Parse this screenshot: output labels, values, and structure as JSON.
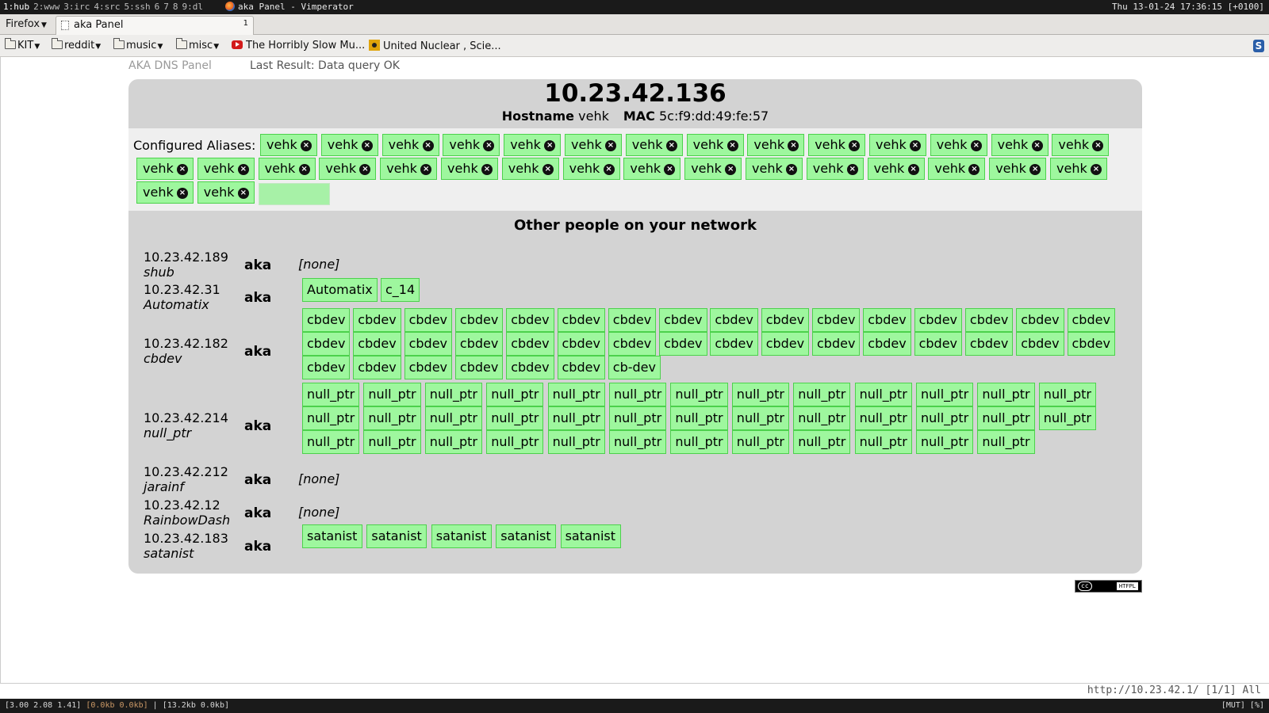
{
  "wm": {
    "workspaces": [
      "1:hub",
      "2:www",
      "3:irc",
      "4:src",
      "5:ssh",
      "6",
      "7",
      "8",
      "9:dl"
    ],
    "active_window": "aka Panel - Vimperator",
    "clock": "Thu 13-01-24 17:36:15 [+0100]"
  },
  "browser": {
    "menu_label": "Firefox",
    "tab_title": "aka Panel",
    "tab_number": "1",
    "bookmarks": {
      "kit": "KIT",
      "reddit": "reddit",
      "music": "music",
      "misc": "misc",
      "horribly": "The Horribly Slow Mu...",
      "nuclear": "United Nuclear , Scie..."
    },
    "status_url": "http://10.23.42.1/ [1/1] All"
  },
  "page": {
    "panel_name": "AKA DNS Panel",
    "last_result_label": "Last Result:",
    "last_result_value": "Data query OK",
    "ip": "10.23.42.136",
    "hostname_label": "Hostname",
    "hostname": "vehk",
    "mac_label": "MAC",
    "mac": "5c:f9:dd:49:fe:57",
    "aliases_label": "Configured Aliases:",
    "alias_remove_symbol": "×",
    "aliases": [
      "vehk",
      "vehk",
      "vehk",
      "vehk",
      "vehk",
      "vehk",
      "vehk",
      "vehk",
      "vehk",
      "vehk",
      "vehk",
      "vehk",
      "vehk",
      "vehk",
      "vehk",
      "vehk",
      "vehk",
      "vehk",
      "vehk",
      "vehk",
      "vehk",
      "vehk",
      "vehk",
      "vehk",
      "vehk",
      "vehk",
      "vehk",
      "vehk",
      "vehk",
      "vehk",
      "vehk",
      "vehk"
    ],
    "others_title": "Other people on your network",
    "aka_label": "aka",
    "none_label": "[none]",
    "peers": [
      {
        "ip": "10.23.42.189",
        "host": "shub",
        "aliases": []
      },
      {
        "ip": "10.23.42.31",
        "host": "Automatix",
        "aliases": [
          "Automatix",
          "c_14"
        ]
      },
      {
        "ip": "10.23.42.182",
        "host": "cbdev",
        "aliases": [
          "cbdev",
          "cbdev",
          "cbdev",
          "cbdev",
          "cbdev",
          "cbdev",
          "cbdev",
          "cbdev",
          "cbdev",
          "cbdev",
          "cbdev",
          "cbdev",
          "cbdev",
          "cbdev",
          "cbdev",
          "cbdev",
          "cbdev",
          "cbdev",
          "cbdev",
          "cbdev",
          "cbdev",
          "cbdev",
          "cbdev",
          "cbdev",
          "cbdev",
          "cbdev",
          "cbdev",
          "cbdev",
          "cbdev",
          "cbdev",
          "cbdev",
          "cbdev",
          "cbdev",
          "cbdev",
          "cbdev",
          "cbdev",
          "cbdev",
          "cbdev",
          "cb-dev"
        ]
      },
      {
        "ip": "10.23.42.214",
        "host": "null_ptr",
        "aliases": [
          "null_ptr",
          "null_ptr",
          "null_ptr",
          "null_ptr",
          "null_ptr",
          "null_ptr",
          "null_ptr",
          "null_ptr",
          "null_ptr",
          "null_ptr",
          "null_ptr",
          "null_ptr",
          "null_ptr",
          "null_ptr",
          "null_ptr",
          "null_ptr",
          "null_ptr",
          "null_ptr",
          "null_ptr",
          "null_ptr",
          "null_ptr",
          "null_ptr",
          "null_ptr",
          "null_ptr",
          "null_ptr",
          "null_ptr",
          "null_ptr",
          "null_ptr",
          "null_ptr",
          "null_ptr",
          "null_ptr",
          "null_ptr",
          "null_ptr",
          "null_ptr",
          "null_ptr",
          "null_ptr",
          "null_ptr",
          "null_ptr"
        ]
      },
      {
        "ip": "10.23.42.212",
        "host": "jarainf",
        "aliases": []
      },
      {
        "ip": "10.23.42.12",
        "host": "RainbowDash",
        "aliases": []
      },
      {
        "ip": "10.23.42.183",
        "host": "satanist",
        "aliases": [
          "satanist",
          "satanist",
          "satanist",
          "satanist",
          "satanist"
        ]
      }
    ],
    "license_badge": "cc",
    "license_text": "HTFPL"
  },
  "bottom_bar": {
    "load": "[3.00 2.08 1.41]",
    "net1": "[0.0kb 0.0kb]",
    "net2": "[13.2kb 0.0kb]",
    "right": "[MUT] [%]"
  },
  "colors": {
    "chip_bg": "#9ef79e",
    "chip_border": "#4cd14c",
    "panel_bg": "#d3d3d3"
  }
}
